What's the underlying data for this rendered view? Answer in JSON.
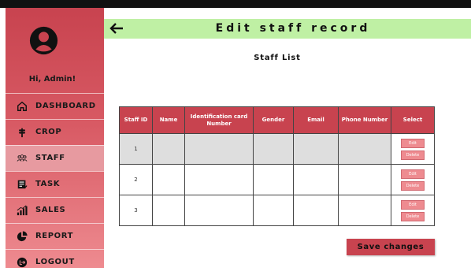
{
  "sidebar": {
    "greeting": "Hi, Admin!",
    "items": [
      {
        "label": "DASHBOARD",
        "icon": "home-icon"
      },
      {
        "label": "CROP",
        "icon": "crop-icon"
      },
      {
        "label": "STAFF",
        "icon": "people-icon",
        "active": true
      },
      {
        "label": "TASK",
        "icon": "task-icon"
      },
      {
        "label": "SALES",
        "icon": "sales-icon"
      },
      {
        "label": "REPORT",
        "icon": "pie-chart-icon"
      },
      {
        "label": "LOGOUT",
        "icon": "logout-icon"
      }
    ]
  },
  "header": {
    "title": "Edit staff record"
  },
  "main": {
    "subtitle": "Staff List",
    "table": {
      "columns": [
        "Staff ID",
        "Name",
        "Identification card Number",
        "Gender",
        "Email",
        "Phone Number",
        "Select"
      ],
      "rows": [
        {
          "id": "1"
        },
        {
          "id": "2"
        },
        {
          "id": "3"
        }
      ],
      "edit_label": "Edit",
      "delete_label": "Delete"
    },
    "save_label": "Save changes"
  },
  "colors": {
    "header_bg": "#bff0a4",
    "accent": "#c8434f",
    "button_pink": "#ee8b90"
  }
}
